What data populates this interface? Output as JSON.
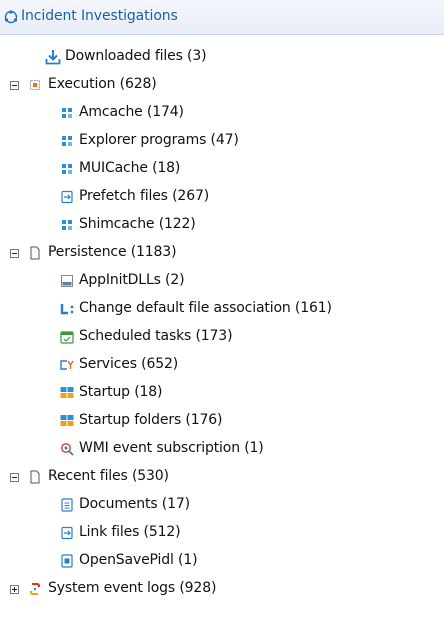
{
  "panel": {
    "title": "Incident Investigations"
  },
  "tree": {
    "downloaded": "Downloaded files (3)",
    "execution": {
      "label": "Execution (628)",
      "children": [
        "Amcache (174)",
        "Explorer programs (47)",
        "MUICache (18)",
        "Prefetch files (267)",
        "Shimcache (122)"
      ]
    },
    "persistence": {
      "label": "Persistence (1183)",
      "children": [
        "AppInitDLLs (2)",
        "Change default file association (161)",
        "Scheduled tasks (173)",
        "Services (652)",
        "Startup (18)",
        "Startup folders (176)",
        "WMI event subscription (1)"
      ]
    },
    "recent": {
      "label": "Recent files (530)",
      "children": [
        "Documents (17)",
        "Link files (512)",
        "OpenSavePidl (1)"
      ]
    },
    "system_event_logs": "System event logs (928)"
  },
  "colors": {
    "header_text": "#1f5fa0",
    "header_bg": "#e9eff8",
    "icon_blue": "#2a7fc9",
    "icon_orange": "#f0a020"
  }
}
